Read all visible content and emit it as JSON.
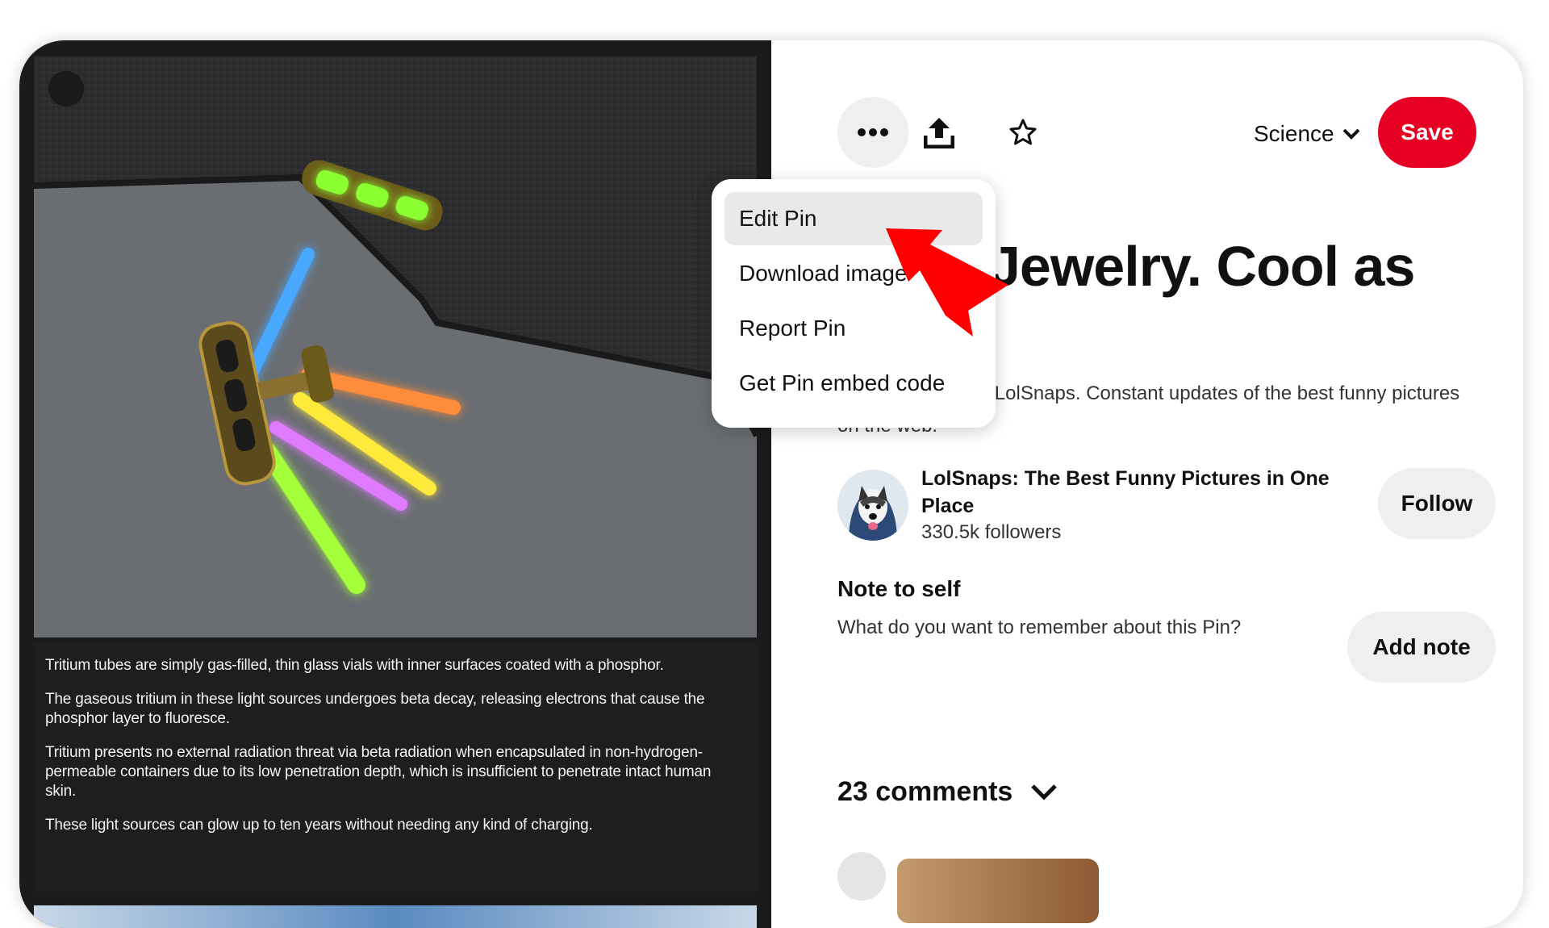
{
  "pin": {
    "title": "Jewelry. Cool as",
    "description": "Brought to you by LolSnaps. Constant updates of the best funny pictures on the web.",
    "board_select_label": "Science",
    "save_label": "Save"
  },
  "image_caption": [
    "Tritium tubes are simply gas-filled, thin glass vials with inner surfaces coated with a phosphor.",
    "The gaseous tritium in these light sources undergoes beta decay, releasing electrons that cause the phosphor layer to fluoresce.",
    "Tritium presents no external radiation threat via beta radiation when encapsulated in non-hydrogen-permeable containers due to its low penetration depth, which is insufficient to penetrate intact human skin.",
    "These light sources can glow up to ten years without needing any kind of charging."
  ],
  "toolbar": {
    "more_icon": "more-horizontal-icon",
    "share_icon": "share-upload-icon",
    "star_icon": "star-outline-icon",
    "board_chevron_icon": "chevron-down-icon"
  },
  "menu": {
    "items": [
      {
        "label": "Edit Pin",
        "highlighted": true
      },
      {
        "label": "Download image",
        "highlighted": false
      },
      {
        "label": "Report Pin",
        "highlighted": false
      },
      {
        "label": "Get Pin embed code",
        "highlighted": false
      }
    ]
  },
  "creator": {
    "name": "LolSnaps: The Best Funny Pictures in One Place",
    "followers": "330.5k followers",
    "follow_label": "Follow"
  },
  "note": {
    "heading": "Note to self",
    "prompt": "What do you want to remember about this Pin?",
    "add_label": "Add note"
  },
  "comments": {
    "label": "23 comments"
  },
  "colors": {
    "save": "#e60023",
    "secondary_button": "#efefef",
    "annotation_arrow": "#ff0000"
  }
}
